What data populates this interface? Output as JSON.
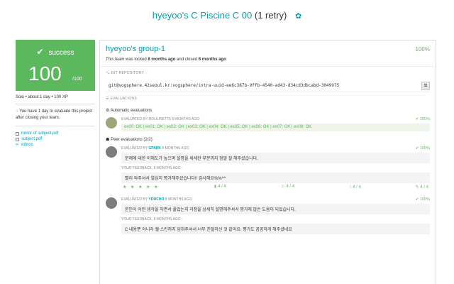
{
  "header": {
    "title": "hyeyoo's C Piscine C 00",
    "retry": "(1 retry)"
  },
  "score": {
    "status": "success",
    "mark": "100",
    "mark_sub": "/100"
  },
  "left": {
    "meta": "Solo • about 1 day • 100 XP",
    "deadline": "You have 1 day to evaluate this project after closing your team.",
    "files": [
      {
        "label": "minor of subject.pdf"
      },
      {
        "label": "subject.pdf"
      },
      {
        "label": "videos"
      }
    ]
  },
  "group": {
    "name": "hyeyoo's group-1",
    "percent": "100%",
    "lock_pre": "This team was locked ",
    "lock_time": "8 months ago",
    "lock_mid": " and closed ",
    "close_time": "8 months ago"
  },
  "git": {
    "label": "GIT REPOSITORY",
    "url": "git@vogsphere.42seoul.kr:vogsphere/intra-uuid-ee6c387b-9ffb-4540-ad43-d34cd3dbcabd-3049975"
  },
  "evaluations": {
    "label": "EVALUATIONS",
    "auto_heading": "Automatic evaluations",
    "peer_heading": "Peer evaluations (2/2)",
    "auto": {
      "evaluator_text": "EVALUATED BY MOULINETTE 8 MONTHS AGO",
      "percent": "100%",
      "results": "ex00: OK | ex01: OK | ex02: OK | ex03: OK | ex04: OK | ex05: OK | ex06: OK | ex07: OK | ex08: OK"
    },
    "peers": [
      {
        "prefix": "EVALUATED BY ",
        "who": "GPARK",
        "when": " 8 MONTHS AGO",
        "percent": "100%",
        "comment": "문제에 대한 이해도가 높으며 설명을 세세한 부분까지 정말 잘 해주셨습니다.",
        "feedback_label": "YOUR FEEDBACK, 8 MONTHS AGO :",
        "feedback": "빨리 와주셔서 열심히 평가해주셨습니다!! 감사해요%%^^",
        "stars": "★ ★ ★ ★ ★",
        "r1": "4 / 4",
        "r2": "4 / 4",
        "r3": "4 / 4",
        "r4": "4 / 4"
      },
      {
        "prefix": "EVALUATED BY ",
        "who": "YOUCHO",
        "when": " 8 MONTHS AGO",
        "percent": "100%",
        "comment": "본인이 어떤 생각을 하면서 풀었는지 과정을 상세히 설명해주셔서 평가에 많은 도움이 되었습니다.",
        "feedback_label": "YOUR FEEDBACK, 8 MONTHS AGO :",
        "feedback": "C 내용뿐 아니라 쉘 스킨까지 입혀주셔서 너무 친절하신 것 같아요. 평가도 꼼꼼하게 해주셨네요"
      }
    ]
  },
  "colors": {
    "accent": "#00a0b0",
    "success": "#5cb85c"
  }
}
